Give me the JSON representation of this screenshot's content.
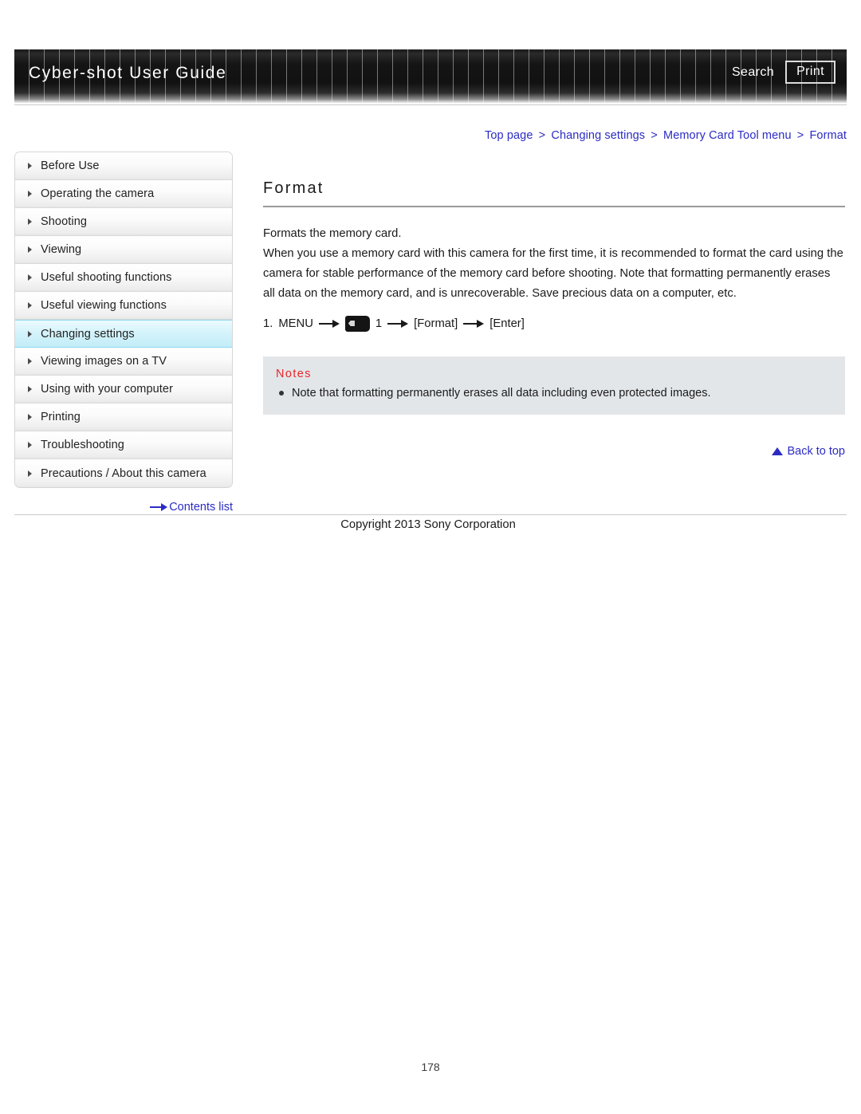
{
  "header": {
    "brand_title": "Cyber-shot User Guide",
    "search_label": "Search",
    "print_label": "Print"
  },
  "breadcrumb": {
    "items": [
      "Top page",
      "Changing settings",
      "Memory Card Tool menu",
      "Format"
    ],
    "separator": ">",
    "color": "#2b2bc4"
  },
  "sidebar": {
    "items": [
      {
        "label": "Before Use",
        "active": false
      },
      {
        "label": "Operating the camera",
        "active": false
      },
      {
        "label": "Shooting",
        "active": false
      },
      {
        "label": "Viewing",
        "active": false
      },
      {
        "label": "Useful shooting functions",
        "active": false
      },
      {
        "label": "Useful viewing functions",
        "active": false
      },
      {
        "label": "Changing settings",
        "active": true
      },
      {
        "label": "Viewing images on a TV",
        "active": false
      },
      {
        "label": "Using with your computer",
        "active": false
      },
      {
        "label": "Printing",
        "active": false
      },
      {
        "label": "Troubleshooting",
        "active": false
      },
      {
        "label": "Precautions / About this camera",
        "active": false
      }
    ],
    "contents_list_label": "Contents list",
    "active_color": "#c2edf8"
  },
  "main": {
    "title": "Format",
    "paragraph_1": "Formats the memory card.",
    "paragraph_2": "When you use a memory card with this camera for the first time, it is recommended to format the card using the camera for stable performance of the memory card before shooting. Note that formatting permanently erases all data on the memory card, and is unrecoverable. Save precious data on a computer, etc.",
    "step": {
      "number": "1.",
      "menu_label": "MENU",
      "icon_name": "memory-card-tool-icon",
      "icon_suffix": "1",
      "option_label": "[Format]",
      "enter_label": "[Enter]"
    },
    "notes": {
      "title": "Notes",
      "title_color": "#e8272b",
      "items": [
        "Note that formatting permanently erases all data including even protected images."
      ]
    },
    "back_to_top_label": "Back to top"
  },
  "footer": {
    "copyright": "Copyright 2013 Sony Corporation",
    "page_number": "178"
  }
}
